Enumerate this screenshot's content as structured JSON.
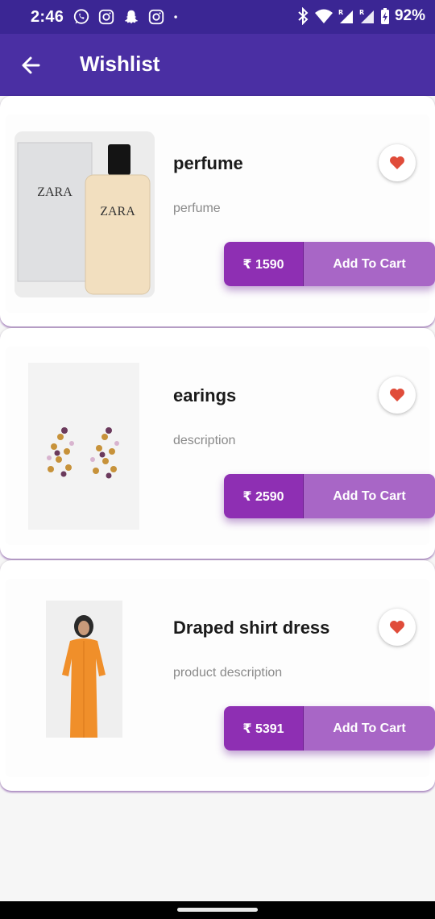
{
  "status_bar": {
    "time": "2:46",
    "notification_icons": [
      "whatsapp-icon",
      "instagram-icon",
      "snapchat-icon",
      "instagram-icon",
      "dot-icon"
    ],
    "system_icons": [
      "bluetooth-icon",
      "wifi-icon",
      "signal-r-icon",
      "signal-r-icon",
      "battery-charging-icon"
    ],
    "battery": "92%"
  },
  "app_bar": {
    "title": "Wishlist",
    "back_icon": "arrow-left-icon",
    "color": "#4a2fa3"
  },
  "items": [
    {
      "name": "perfume",
      "description": "perfume",
      "price": "₹ 1590",
      "cart_label": "Add To Cart",
      "image": "perfume-bottle-image"
    },
    {
      "name": "earings",
      "description": "description",
      "price": "₹ 2590",
      "cart_label": "Add To Cart",
      "image": "earrings-image"
    },
    {
      "name": "Draped shirt dress",
      "description": "product description",
      "price": "₹ 5391",
      "cart_label": "Add To Cart",
      "image": "orange-dress-image"
    }
  ],
  "colors": {
    "price_bg": "#8e2fb3",
    "cart_bg": "#a866c6",
    "heart": "#e04c3a"
  }
}
